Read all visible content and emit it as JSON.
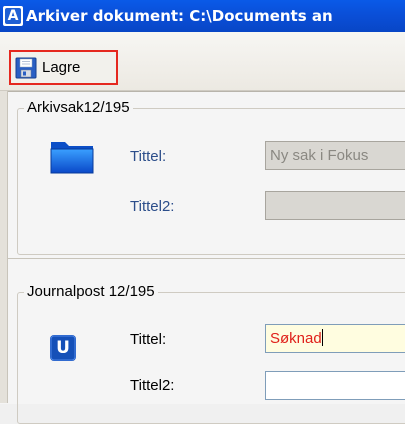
{
  "window": {
    "title": "Arkiver dokument: C:\\Documents an",
    "app_icon_letter": "A"
  },
  "toolbar": {
    "save_label": "Lagre",
    "save_icon": "floppy-disk-icon",
    "highlight_color": "#e5281f"
  },
  "arkivsak": {
    "legend": "Arkivsak12/195",
    "icon": "folder-icon",
    "fields": [
      {
        "label": "Tittel:",
        "value": "Ny sak i Fokus",
        "state": "disabled"
      },
      {
        "label": "Tittel2:",
        "value": "",
        "state": "disabled"
      }
    ]
  },
  "journalpost": {
    "legend": "Journalpost 12/195",
    "icon": "u-badge-icon",
    "icon_letter": "U",
    "fields": [
      {
        "label": "Tittel:",
        "value": "Søknad",
        "state": "active"
      },
      {
        "label": "Tittel2:",
        "value": "",
        "state": "normal"
      }
    ]
  },
  "colors": {
    "titlebar": "#0a4fd8",
    "active_text": "#e0201a",
    "label_blue": "#2b4d8a"
  }
}
